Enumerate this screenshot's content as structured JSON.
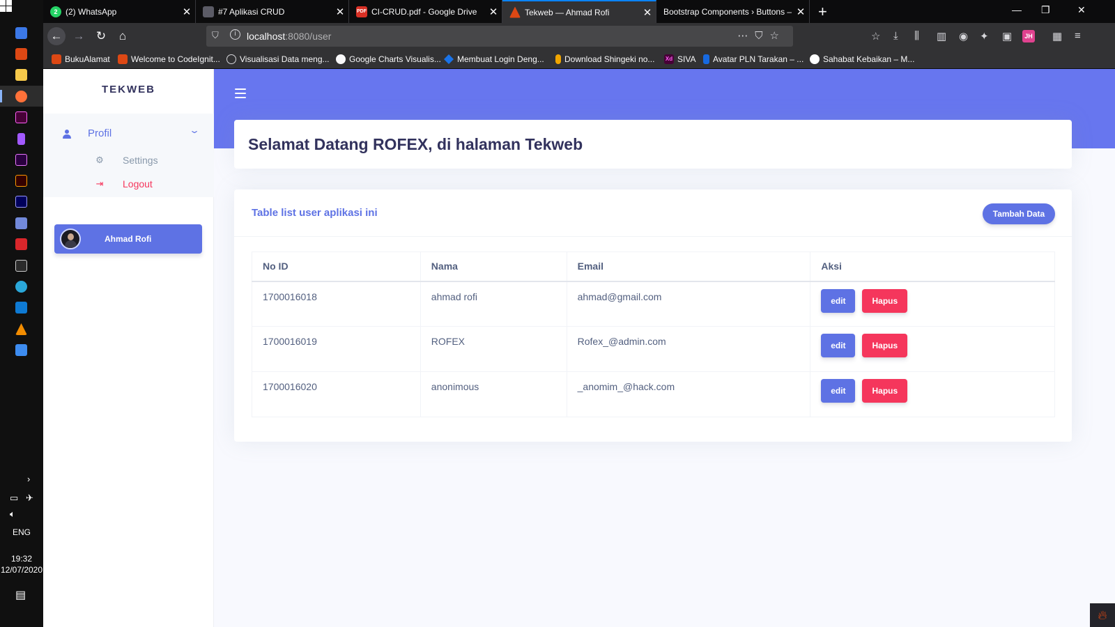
{
  "taskbar": {
    "language": "ENG",
    "time": "19:32",
    "date": "12/07/2020",
    "icons": [
      "windows-start-icon",
      "app-icon",
      "file-explorer-icon",
      "firefox-icon",
      "adobe-xd-icon",
      "figma-icon",
      "premiere-icon",
      "illustrator-icon",
      "after-effects-icon",
      "discord-icon",
      "mail-icon",
      "terminal-icon",
      "edge-icon",
      "vscode-icon",
      "vlc-icon",
      "app-icon"
    ]
  },
  "browser": {
    "tabs": [
      {
        "label": "(2) WhatsApp",
        "color": "#25d366",
        "fav_text": "2"
      },
      {
        "label": "#7 Aplikasi CRUD",
        "color": "#5b5b66",
        "fav_text": ""
      },
      {
        "label": "CI-CRUD.pdf - Google Drive",
        "color": "#d93025",
        "fav_text": "PDF"
      },
      {
        "label": "Tekweb — Ahmad Rofi",
        "color": "#dd4814",
        "fav_text": ""
      },
      {
        "label": "Bootstrap Components › Buttons –",
        "color": "",
        "fav_text": ""
      }
    ],
    "url_host": "localhost",
    "url_path": ":8080/user",
    "bookmarks": [
      {
        "label": "BukuAlamat",
        "color": "#dd4814",
        "fav_text": ""
      },
      {
        "label": "Welcome to CodeIgnit...",
        "color": "#dd4814",
        "fav_text": ""
      },
      {
        "label": "Visualisasi Data meng...",
        "color": "#5b5b66",
        "fav_text": ""
      },
      {
        "label": "Google Charts Visualis...",
        "color": "#24292e",
        "fav_text": ""
      },
      {
        "label": "Membuat Login Deng...",
        "color": "#1a73e8",
        "fav_text": ""
      },
      {
        "label": "Download Shingeki no...",
        "color": "#f0a500",
        "fav_text": ""
      },
      {
        "label": "SIVA",
        "color": "#470137",
        "fav_text": "Xd"
      },
      {
        "label": "Avatar PLN Tarakan – ...",
        "color": "#1769e0",
        "fav_text": ""
      },
      {
        "label": "Sahabat Kebaikan – M...",
        "color": "#ffffff",
        "fav_text": ""
      }
    ],
    "jh_label": "JH"
  },
  "sidebar": {
    "brand": "TEKWEB",
    "menu_profil": "Profil",
    "sub_settings": "Settings",
    "sub_logout": "Logout",
    "user_name": "Ahmad Rofi"
  },
  "main": {
    "welcome": "Selamat Datang ROFEX, di halaman Tekweb",
    "card_title": "Table list user aplikasi ini",
    "add_button": "Tambah Data",
    "table": {
      "headers": [
        "No ID",
        "Nama",
        "Email",
        "Aksi"
      ],
      "rows": [
        {
          "id": "1700016018",
          "nama": "ahmad rofi",
          "email": "ahmad@gmail.com"
        },
        {
          "id": "1700016019",
          "nama": "ROFEX",
          "email": "Rofex_@admin.com"
        },
        {
          "id": "1700016020",
          "nama": "anonimous",
          "email": "_anomim_@hack.com"
        }
      ],
      "edit_label": "edit",
      "delete_label": "Hapus"
    }
  },
  "colors": {
    "primary": "#5e72e4",
    "hero": "#6776ef",
    "danger": "#f5365c",
    "heading": "#32325d"
  }
}
